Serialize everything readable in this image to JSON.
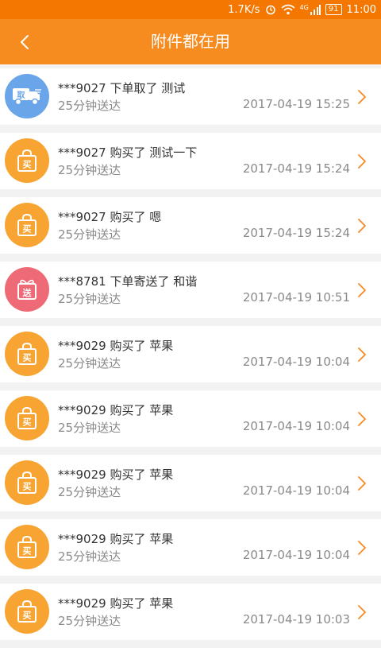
{
  "status_bar": {
    "speed": "1.7K/s",
    "network": "4G",
    "battery": "91",
    "time": "11:00"
  },
  "header": {
    "title": "附件都在用",
    "back_icon": "chevron-left-icon"
  },
  "colors": {
    "status_bar": "#f37700",
    "header": "#f68b1f",
    "buy_badge": "#f8a432",
    "pick_badge": "#6aa5ea",
    "send_badge": "#ef6a77",
    "chevron": "#f68b1f"
  },
  "items": [
    {
      "type": "pick",
      "badge": "取",
      "icon": "truck-icon",
      "title": "***9027 下单取了 测试",
      "subtitle": "25分钟送达",
      "time": "2017-04-19 15:25"
    },
    {
      "type": "buy",
      "badge": "买",
      "icon": "shopping-bag-icon",
      "title": "***9027 购买了 测试一下",
      "subtitle": "25分钟送达",
      "time": "2017-04-19 15:24"
    },
    {
      "type": "buy",
      "badge": "买",
      "icon": "shopping-bag-icon",
      "title": "***9027 购买了 嗯",
      "subtitle": "25分钟送达",
      "time": "2017-04-19 15:24"
    },
    {
      "type": "send",
      "badge": "送",
      "icon": "gift-icon",
      "title": "***8781 下单寄送了 和谐",
      "subtitle": "25分钟送达",
      "time": "2017-04-19 10:51"
    },
    {
      "type": "buy",
      "badge": "买",
      "icon": "shopping-bag-icon",
      "title": "***9029 购买了 苹果",
      "subtitle": "25分钟送达",
      "time": "2017-04-19 10:04"
    },
    {
      "type": "buy",
      "badge": "买",
      "icon": "shopping-bag-icon",
      "title": "***9029 购买了 苹果",
      "subtitle": "25分钟送达",
      "time": "2017-04-19 10:04"
    },
    {
      "type": "buy",
      "badge": "买",
      "icon": "shopping-bag-icon",
      "title": "***9029 购买了 苹果",
      "subtitle": "25分钟送达",
      "time": "2017-04-19 10:04"
    },
    {
      "type": "buy",
      "badge": "买",
      "icon": "shopping-bag-icon",
      "title": "***9029 购买了 苹果",
      "subtitle": "25分钟送达",
      "time": "2017-04-19 10:04"
    },
    {
      "type": "buy",
      "badge": "买",
      "icon": "shopping-bag-icon",
      "title": "***9029 购买了 苹果",
      "subtitle": "25分钟送达",
      "time": "2017-04-19 10:03"
    }
  ]
}
